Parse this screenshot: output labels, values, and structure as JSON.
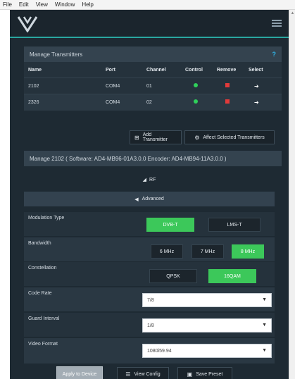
{
  "menubar": {
    "items": [
      "File",
      "Edit",
      "View",
      "Window",
      "Help"
    ]
  },
  "colors": {
    "accent": "#2aa7a0",
    "active_green": "#3cc85a",
    "status_green": "#2fd05a",
    "remove_red": "#e23a3a",
    "help_blue": "#2fb4e8"
  },
  "header": {
    "logo_icon": "v-logo-icon",
    "menu_icon": "hamburger-icon"
  },
  "transmitters": {
    "title": "Manage Transmitters",
    "help": "?",
    "columns": [
      "Name",
      "Port",
      "Channel",
      "Control",
      "Remove",
      "Select"
    ],
    "rows": [
      {
        "name": "2102",
        "port": "COM4",
        "channel": "01"
      },
      {
        "name": "2326",
        "port": "COM4",
        "channel": "02"
      }
    ],
    "add_button": "Add Transmitter",
    "affect_button": "Affect Selected Transmitters"
  },
  "manage": {
    "title": "Manage 2102 ( Software: AD4-MB96-01A3.0.0 Encoder: AD4-MB94-11A3.0.0 )",
    "rf_label": "RF",
    "advanced_label": "Advanced"
  },
  "fields": {
    "modulation": {
      "label": "Modulation Type",
      "options": [
        "DVB-T",
        "LMS-T"
      ],
      "selected": "DVB-T"
    },
    "bandwidth": {
      "label": "Bandwidth",
      "options": [
        "6 MHz",
        "7 MHz",
        "8 MHz"
      ],
      "selected": "8 MHz"
    },
    "constellation": {
      "label": "Constellation",
      "options": [
        "QPSK",
        "16QAM"
      ],
      "selected": "16QAM"
    },
    "code_rate": {
      "label": "Code Rate",
      "value": "7/8"
    },
    "guard_interval": {
      "label": "Guard Interval",
      "value": "1/8"
    },
    "video_format": {
      "label": "Video Format",
      "value": "1080i59.94"
    }
  },
  "footer": {
    "apply": "Apply to Device",
    "view_config": "View Config",
    "save_preset": "Save Preset"
  }
}
